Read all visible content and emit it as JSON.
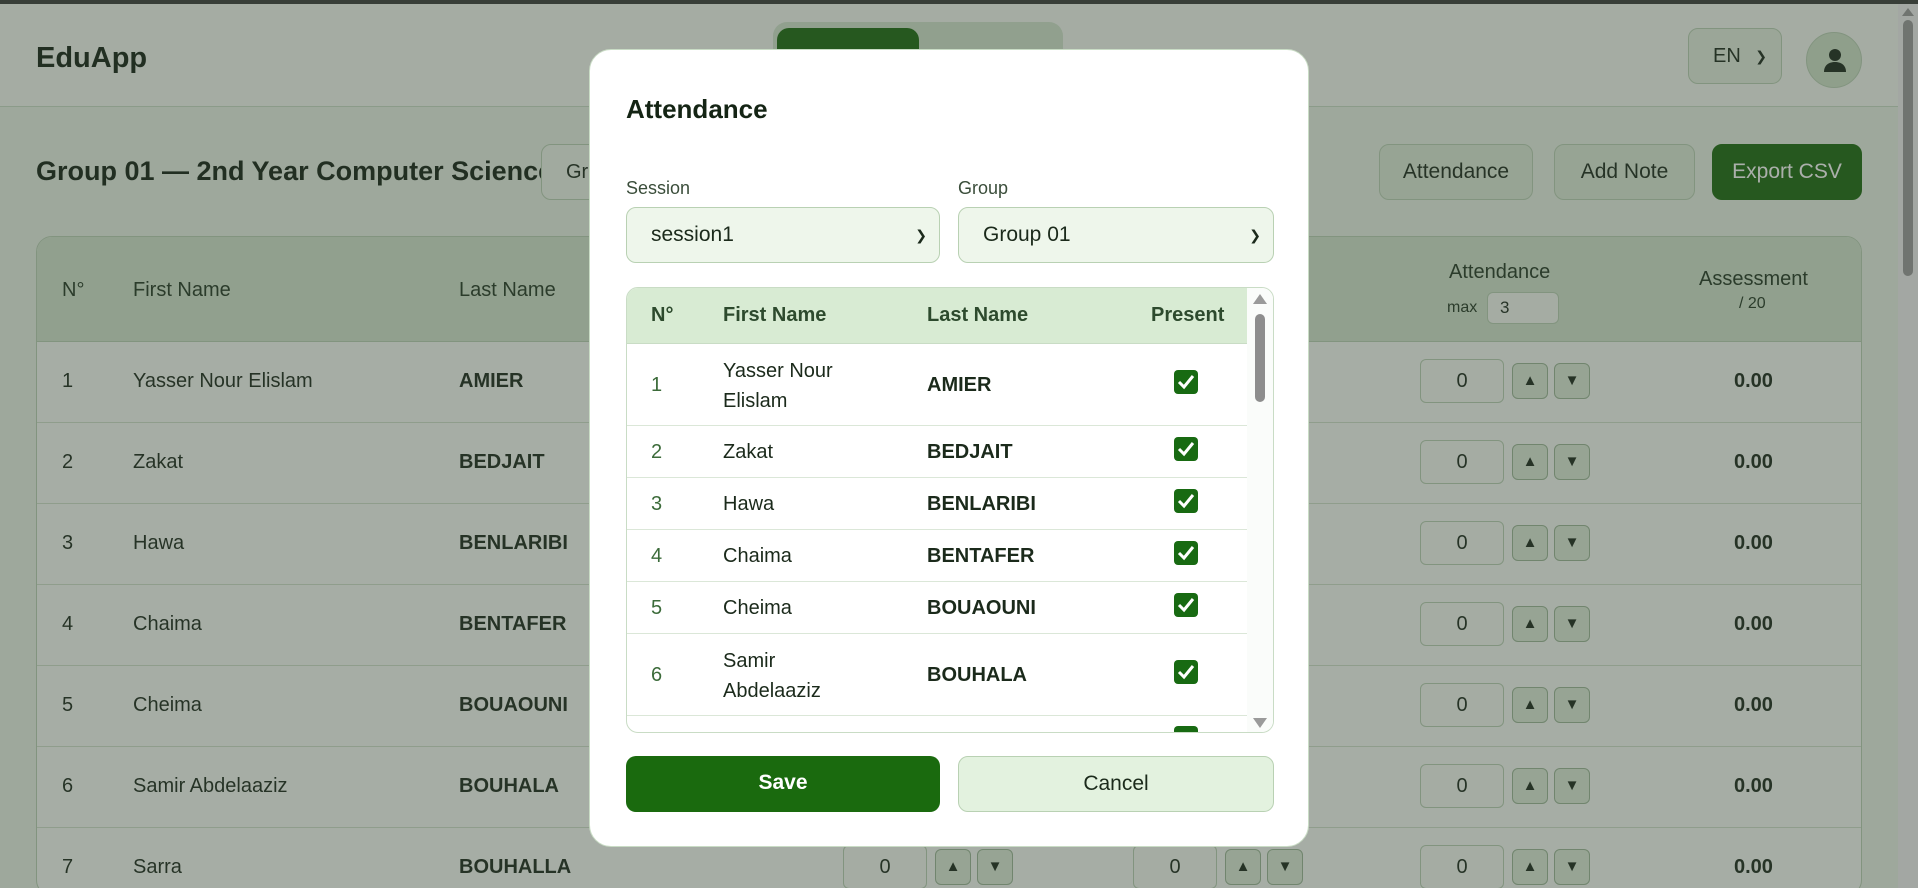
{
  "app": {
    "name": "EduApp",
    "language": "EN"
  },
  "page": {
    "title": "Group 01 — 2nd Year Computer Science",
    "group_select": "Gr"
  },
  "toolbar": {
    "attendance": "Attendance",
    "add_note": "Add Note",
    "export": "Export CSV"
  },
  "main_table": {
    "headers": {
      "num": "N°",
      "first": "First Name",
      "last": "Last Name",
      "attendance": "Attendance",
      "max_label": "max",
      "max_value": "3",
      "assessment": "Assessment",
      "assessment_sub": "/ 20"
    },
    "rows": [
      {
        "num": "1",
        "first": "Yasser Nour Elislam",
        "last": "AMIER",
        "att": "0",
        "assess": "0.00"
      },
      {
        "num": "2",
        "first": "Zakat",
        "last": "BEDJAIT",
        "att": "0",
        "assess": "0.00"
      },
      {
        "num": "3",
        "first": "Hawa",
        "last": "BENLARIBI",
        "att": "0",
        "assess": "0.00"
      },
      {
        "num": "4",
        "first": "Chaima",
        "last": "BENTAFER",
        "att": "0",
        "assess": "0.00"
      },
      {
        "num": "5",
        "first": "Cheima",
        "last": "BOUAOUNI",
        "att": "0",
        "assess": "0.00"
      },
      {
        "num": "6",
        "first": "Samir Abdelaaziz",
        "last": "BOUHALA",
        "att": "0",
        "assess": "0.00"
      },
      {
        "num": "7",
        "first": "Sarra",
        "last": "BOUHALLA",
        "att": "0",
        "mid1": "0",
        "mid2": "0",
        "assess": "0.00"
      }
    ]
  },
  "modal": {
    "title": "Attendance",
    "session_label": "Session",
    "session_value": "session1",
    "group_label": "Group",
    "group_value": "Group 01",
    "headers": {
      "num": "N°",
      "first": "First Name",
      "last": "Last Name",
      "present": "Present"
    },
    "rows": [
      {
        "num": "1",
        "first_line1": "Yasser Nour",
        "first_line2": "Elislam",
        "last": "AMIER",
        "present": true
      },
      {
        "num": "2",
        "first_line1": "Zakat",
        "first_line2": "",
        "last": "BEDJAIT",
        "present": true
      },
      {
        "num": "3",
        "first_line1": "Hawa",
        "first_line2": "",
        "last": "BENLARIBI",
        "present": true
      },
      {
        "num": "4",
        "first_line1": "Chaima",
        "first_line2": "",
        "last": "BENTAFER",
        "present": true
      },
      {
        "num": "5",
        "first_line1": "Cheima",
        "first_line2": "",
        "last": "BOUAOUNI",
        "present": true
      },
      {
        "num": "6",
        "first_line1": "Samir",
        "first_line2": "Abdelaaziz",
        "last": "BOUHALA",
        "present": true
      }
    ],
    "save": "Save",
    "cancel": "Cancel"
  },
  "colors": {
    "primary": "#1a6a0e",
    "header_bg": "#d2e6cd",
    "page_bg": "#e9f3e6"
  }
}
